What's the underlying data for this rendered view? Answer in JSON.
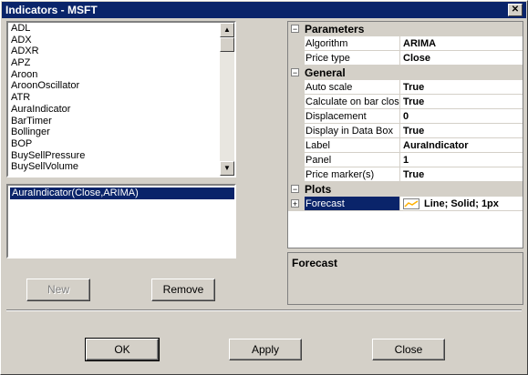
{
  "window": {
    "title": "Indicators - MSFT",
    "close_glyph": "✕"
  },
  "indicator_list": {
    "items": [
      "ADL",
      "ADX",
      "ADXR",
      "APZ",
      "Aroon",
      "AroonOscillator",
      "ATR",
      "AuraIndicator",
      "BarTimer",
      "Bollinger",
      "BOP",
      "BuySellPressure",
      "BuySellVolume"
    ]
  },
  "applied_list": {
    "items": [
      "AuraIndicator(Close,ARIMA)"
    ]
  },
  "buttons": {
    "new": "New",
    "remove": "Remove",
    "ok": "OK",
    "apply": "Apply",
    "close": "Close"
  },
  "properties": {
    "parameters_label": "Parameters",
    "algorithm_name": "Algorithm",
    "algorithm_value": "ARIMA",
    "price_type_name": "Price type",
    "price_type_value": "Close",
    "general_label": "General",
    "auto_scale_name": "Auto scale",
    "auto_scale_value": "True",
    "calc_name": "Calculate on bar close",
    "calc_value": "True",
    "displacement_name": "Displacement",
    "displacement_value": "0",
    "display_databox_name": "Display in Data Box",
    "display_databox_value": "True",
    "label_name": "Label",
    "label_value": "AuraIndicator",
    "panel_name": "Panel",
    "panel_value": "1",
    "price_marker_name": "Price marker(s)",
    "price_marker_value": "True",
    "plots_label": "Plots",
    "forecast_name": "Forecast",
    "forecast_value": "Line; Solid; 1px",
    "collapse_glyph": "−",
    "expand_glyph": "+"
  },
  "description": {
    "title": "Forecast"
  },
  "colors": {
    "titlebar": "#0a246a",
    "selection": "#0a246a",
    "plot_line": "#ffb000"
  }
}
